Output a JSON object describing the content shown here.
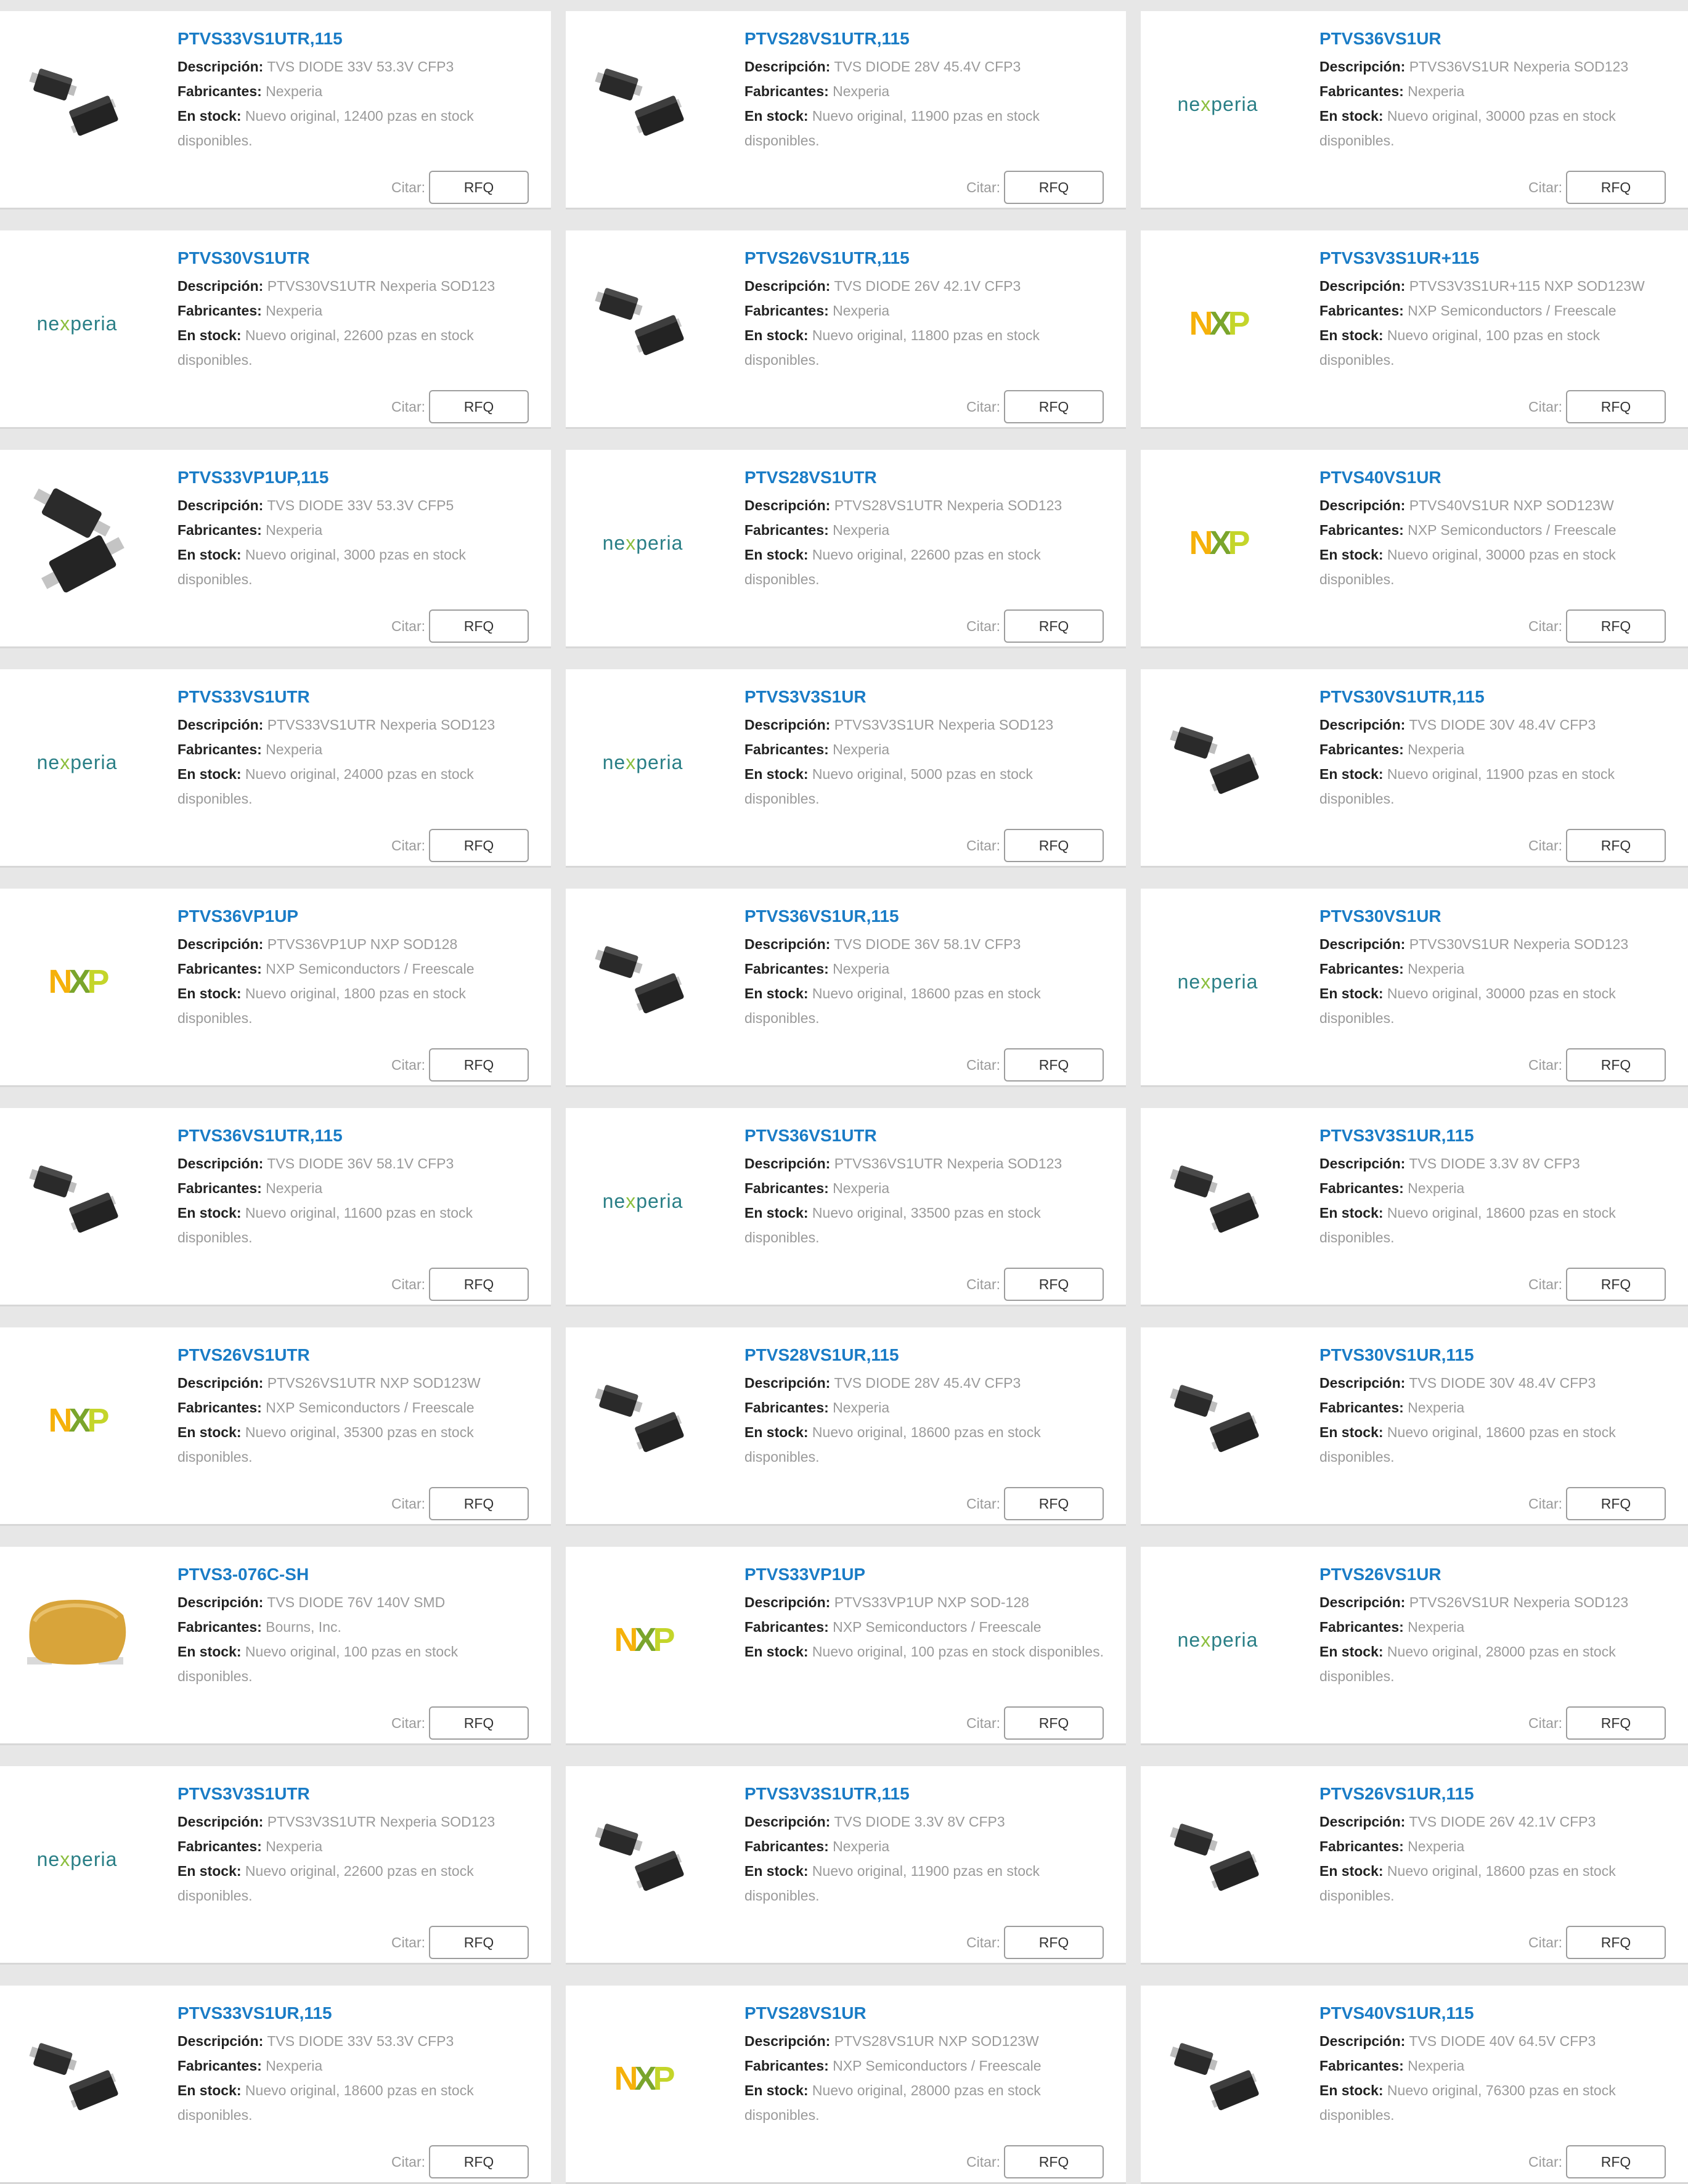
{
  "labels": {
    "descripcion": "Descripción:",
    "fabricantes": "Fabricantes:",
    "en_stock": "En stock:",
    "citar": "Citar:",
    "rfq": "RFQ"
  },
  "colors": {
    "link": "#1a7cc6",
    "background": "#e7e7e7"
  },
  "products": [
    {
      "part": "PTVS33VS1UTR,115",
      "desc": "TVS DIODE 33V 53.3V CFP3",
      "mfr": "Nexperia",
      "stock": "Nuevo original, 12400 pzas en stock disponibles.",
      "image": "sod-package-icon"
    },
    {
      "part": "PTVS28VS1UTR,115",
      "desc": "TVS DIODE 28V 45.4V CFP3",
      "mfr": "Nexperia",
      "stock": "Nuevo original, 11900 pzas en stock disponibles.",
      "image": "sod-package-icon"
    },
    {
      "part": "PTVS36VS1UR",
      "desc": "PTVS36VS1UR Nexperia SOD123",
      "mfr": "Nexperia",
      "stock": "Nuevo original, 30000 pzas en stock disponibles.",
      "image": "nexperia-logo"
    },
    {
      "part": "PTVS30VS1UTR",
      "desc": "PTVS30VS1UTR Nexperia SOD123",
      "mfr": "Nexperia",
      "stock": "Nuevo original, 22600 pzas en stock disponibles.",
      "image": "nexperia-logo"
    },
    {
      "part": "PTVS26VS1UTR,115",
      "desc": "TVS DIODE 26V 42.1V CFP3",
      "mfr": "Nexperia",
      "stock": "Nuevo original, 11800 pzas en stock disponibles.",
      "image": "sod-package-icon"
    },
    {
      "part": "PTVS3V3S1UR+115",
      "desc": "PTVS3V3S1UR+115 NXP SOD123W",
      "mfr": "NXP Semiconductors / Freescale",
      "stock": "Nuevo original, 100 pzas en stock disponibles.",
      "image": "nxp-logo"
    },
    {
      "part": "PTVS33VP1UP,115",
      "desc": "TVS DIODE 33V 53.3V CFP5",
      "mfr": "Nexperia",
      "stock": "Nuevo original, 3000 pzas en stock disponibles.",
      "image": "sod-package-large-icon"
    },
    {
      "part": "PTVS28VS1UTR",
      "desc": "PTVS28VS1UTR Nexperia SOD123",
      "mfr": "Nexperia",
      "stock": "Nuevo original, 22600 pzas en stock disponibles.",
      "image": "nexperia-logo"
    },
    {
      "part": "PTVS40VS1UR",
      "desc": "PTVS40VS1UR NXP SOD123W",
      "mfr": "NXP Semiconductors / Freescale",
      "stock": "Nuevo original, 30000 pzas en stock disponibles.",
      "image": "nxp-logo"
    },
    {
      "part": "PTVS33VS1UTR",
      "desc": "PTVS33VS1UTR Nexperia SOD123",
      "mfr": "Nexperia",
      "stock": "Nuevo original, 24000 pzas en stock disponibles.",
      "image": "nexperia-logo"
    },
    {
      "part": "PTVS3V3S1UR",
      "desc": "PTVS3V3S1UR Nexperia SOD123",
      "mfr": "Nexperia",
      "stock": "Nuevo original, 5000 pzas en stock disponibles.",
      "image": "nexperia-logo"
    },
    {
      "part": "PTVS30VS1UTR,115",
      "desc": "TVS DIODE 30V 48.4V CFP3",
      "mfr": "Nexperia",
      "stock": "Nuevo original, 11900 pzas en stock disponibles.",
      "image": "sod-package-icon"
    },
    {
      "part": "PTVS36VP1UP",
      "desc": "PTVS36VP1UP NXP SOD128",
      "mfr": "NXP Semiconductors / Freescale",
      "stock": "Nuevo original, 1800 pzas en stock disponibles.",
      "image": "nxp-logo"
    },
    {
      "part": "PTVS36VS1UR,115",
      "desc": "TVS DIODE 36V 58.1V CFP3",
      "mfr": "Nexperia",
      "stock": "Nuevo original, 18600 pzas en stock disponibles.",
      "image": "sod-package-icon"
    },
    {
      "part": "PTVS30VS1UR",
      "desc": "PTVS30VS1UR Nexperia SOD123",
      "mfr": "Nexperia",
      "stock": "Nuevo original, 30000 pzas en stock disponibles.",
      "image": "nexperia-logo"
    },
    {
      "part": "PTVS36VS1UTR,115",
      "desc": "TVS DIODE 36V 58.1V CFP3",
      "mfr": "Nexperia",
      "stock": "Nuevo original, 11600 pzas en stock disponibles.",
      "image": "sod-package-icon"
    },
    {
      "part": "PTVS36VS1UTR",
      "desc": "PTVS36VS1UTR Nexperia SOD123",
      "mfr": "Nexperia",
      "stock": "Nuevo original, 33500 pzas en stock disponibles.",
      "image": "nexperia-logo"
    },
    {
      "part": "PTVS3V3S1UR,115",
      "desc": "TVS DIODE 3.3V 8V CFP3",
      "mfr": "Nexperia",
      "stock": "Nuevo original, 18600 pzas en stock disponibles.",
      "image": "sod-package-icon"
    },
    {
      "part": "PTVS26VS1UTR",
      "desc": "PTVS26VS1UTR NXP SOD123W",
      "mfr": "NXP Semiconductors / Freescale",
      "stock": "Nuevo original, 35300 pzas en stock disponibles.",
      "image": "nxp-logo"
    },
    {
      "part": "PTVS28VS1UR,115",
      "desc": "TVS DIODE 28V 45.4V CFP3",
      "mfr": "Nexperia",
      "stock": "Nuevo original, 18600 pzas en stock disponibles.",
      "image": "sod-package-icon"
    },
    {
      "part": "PTVS30VS1UR,115",
      "desc": "TVS DIODE 30V 48.4V CFP3",
      "mfr": "Nexperia",
      "stock": "Nuevo original, 18600 pzas en stock disponibles.",
      "image": "sod-package-icon"
    },
    {
      "part": "PTVS3-076C-SH",
      "desc": "TVS DIODE 76V 140V SMD",
      "mfr": "Bourns, Inc.",
      "stock": "Nuevo original, 100 pzas en stock disponibles.",
      "image": "bourns-component-icon"
    },
    {
      "part": "PTVS33VP1UP",
      "desc": "PTVS33VP1UP   NXP SOD-128",
      "mfr": "NXP Semiconductors / Freescale",
      "stock": "Nuevo original, 100 pzas en stock disponibles.",
      "image": "nxp-logo"
    },
    {
      "part": "PTVS26VS1UR",
      "desc": "PTVS26VS1UR Nexperia SOD123",
      "mfr": "Nexperia",
      "stock": "Nuevo original, 28000 pzas en stock disponibles.",
      "image": "nexperia-logo"
    },
    {
      "part": "PTVS3V3S1UTR",
      "desc": "PTVS3V3S1UTR Nexperia SOD123",
      "mfr": "Nexperia",
      "stock": "Nuevo original, 22600 pzas en stock disponibles.",
      "image": "nexperia-logo"
    },
    {
      "part": "PTVS3V3S1UTR,115",
      "desc": "TVS DIODE 3.3V 8V CFP3",
      "mfr": "Nexperia",
      "stock": "Nuevo original, 11900 pzas en stock disponibles.",
      "image": "sod-package-icon"
    },
    {
      "part": "PTVS26VS1UR,115",
      "desc": "TVS DIODE 26V 42.1V CFP3",
      "mfr": "Nexperia",
      "stock": "Nuevo original, 18600 pzas en stock disponibles.",
      "image": "sod-package-icon"
    },
    {
      "part": "PTVS33VS1UR,115",
      "desc": "TVS DIODE 33V 53.3V CFP3",
      "mfr": "Nexperia",
      "stock": "Nuevo original, 18600 pzas en stock disponibles.",
      "image": "sod-package-icon"
    },
    {
      "part": "PTVS28VS1UR",
      "desc": "PTVS28VS1UR   NXP SOD123W",
      "mfr": "NXP Semiconductors / Freescale",
      "stock": "Nuevo original, 28000 pzas en stock disponibles.",
      "image": "nxp-logo"
    },
    {
      "part": "PTVS40VS1UR,115",
      "desc": "TVS DIODE 40V 64.5V CFP3",
      "mfr": "Nexperia",
      "stock": "Nuevo original, 76300 pzas en stock disponibles.",
      "image": "sod-package-icon"
    }
  ]
}
